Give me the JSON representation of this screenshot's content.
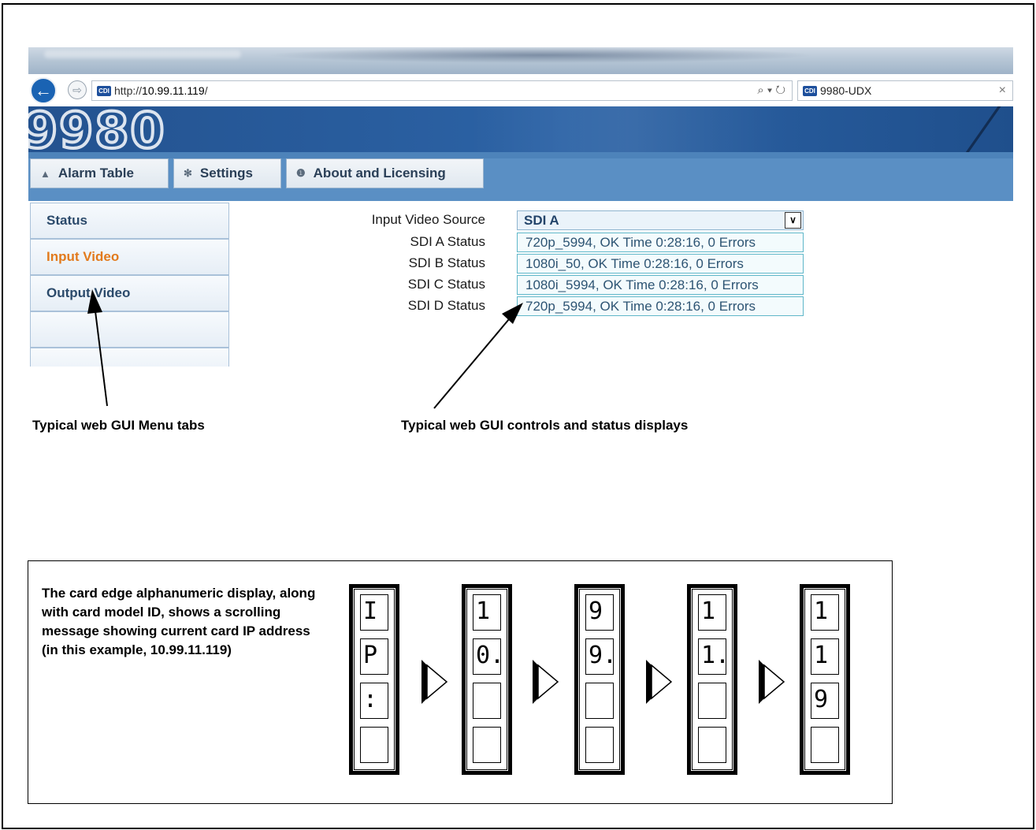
{
  "browser": {
    "url_prefix": "http://",
    "url_host": "10.99.11.119",
    "url_suffix": "/",
    "favicon_text": "CDI",
    "tab_title": "9980-UDX",
    "close_glyph": "×",
    "search_glyph": "⌕ ▾ ↻"
  },
  "banner": {
    "logo_text": "9980"
  },
  "menu": {
    "items": [
      {
        "label": "Alarm Table",
        "icon": "warning-icon",
        "glyph": "▲"
      },
      {
        "label": "Settings",
        "icon": "gear-icon",
        "glyph": "✻"
      },
      {
        "label": "About and Licensing",
        "icon": "info-icon",
        "glyph": "❶"
      }
    ]
  },
  "sidebar": {
    "items": [
      {
        "label": "Status",
        "active": false
      },
      {
        "label": "Input Video",
        "active": true
      },
      {
        "label": "Output Video",
        "active": false
      },
      {
        "label": "",
        "active": false
      },
      {
        "label": "",
        "active": false
      }
    ]
  },
  "form": {
    "input_source_label": "Input Video Source",
    "input_source_value": "SDI A",
    "rows": [
      {
        "label": "SDI A Status",
        "value": "720p_5994, OK Time 0:28:16, 0 Errors"
      },
      {
        "label": "SDI B Status",
        "value": "1080i_50, OK Time 0:28:16, 0 Errors"
      },
      {
        "label": "SDI C Status",
        "value": "1080i_5994, OK Time 0:28:16, 0 Errors"
      },
      {
        "label": "SDI D Status",
        "value": "720p_5994, OK Time 0:28:16, 0 Errors"
      }
    ]
  },
  "callouts": {
    "menu_tabs": "Typical web GUI Menu tabs",
    "controls": "Typical web GUI controls and status displays"
  },
  "card_edge": {
    "description": "The card edge alphanumeric display, along with card model ID, shows a scrolling message showing current card IP address (in this example, 10.99.11.119)",
    "displays": [
      [
        "I",
        "P",
        ":",
        ""
      ],
      [
        "1",
        "0.",
        "",
        ""
      ],
      [
        "9",
        "9.",
        "",
        ""
      ],
      [
        "1",
        "1.",
        "",
        ""
      ],
      [
        "1",
        "1",
        "9",
        ""
      ]
    ]
  }
}
